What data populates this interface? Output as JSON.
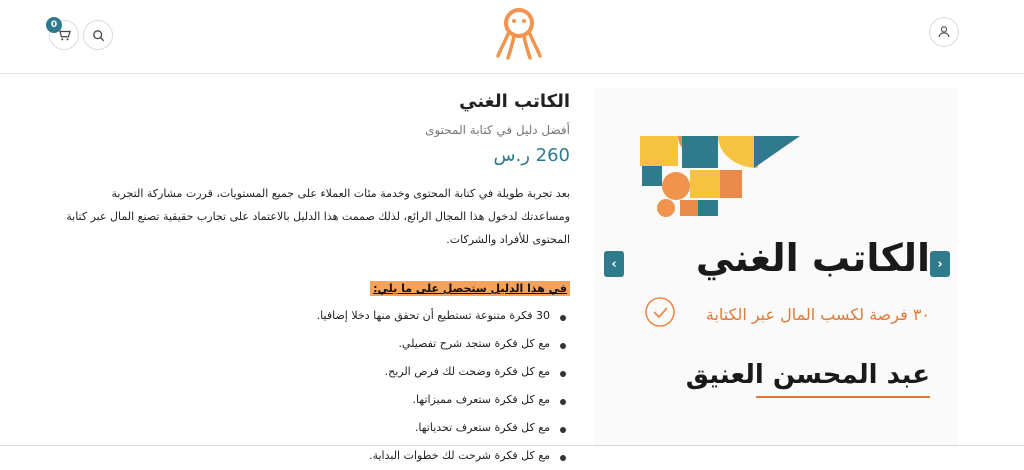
{
  "header": {
    "cart_count": "0",
    "icons": {
      "cart": "cart-icon",
      "search": "search-icon",
      "user": "user-icon",
      "logo": "octopus-logo"
    }
  },
  "product": {
    "title": "الكاتب الغني",
    "subtitle": "أفضل دليل في كتابة المحتوى",
    "price": "260 ر.س",
    "description": "بعد تجربة طويلة في كتابة المحتوى وخدمة مئات العملاء على جميع المستويات، قررت مشاركة التجربة ومساعدتك لدخول هذا المجال الرائع، لذلك صممت هذا الدليل بالاعتماد على تجارب حقيقية تصنع المال عبر كتابة المحتوى للأفراد والشركات.",
    "features_heading": "في هذا الدليل ستحصل على ما يلي:",
    "features": [
      "30 فكرة متنوعة تستطيع أن تحقق منها دخلا إضافيا.",
      "مع كل فكرة ستجد شرح تفصيلي.",
      "مع كل فكرة وضحت لك فرص الربح.",
      "مع كل فكرة ستعرف مميزاتها.",
      "مع كل فكرة ستعرف تحدياتها.",
      "مع كل فكرة شرحت لك خطوات البداية."
    ]
  },
  "cover": {
    "title": "الكاتب الغني",
    "subtitle": "٣٠ فرصة لكسب المال عبر الكتابة",
    "author": "عبد المحسن العنيق"
  },
  "colors": {
    "accent": "#2f7a8c",
    "orange": "#e07a38",
    "highlight": "#f3a35b"
  }
}
